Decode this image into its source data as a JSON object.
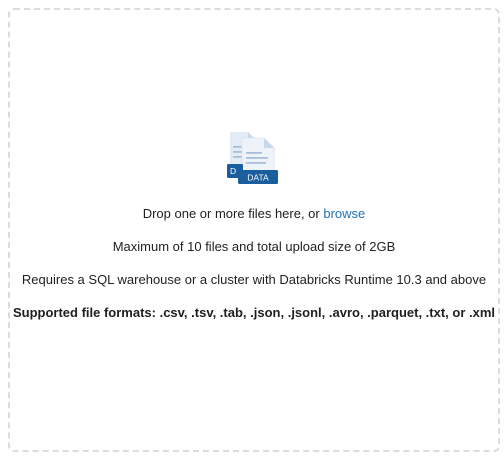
{
  "dropzone": {
    "icon": "data-file-icon",
    "icon_label": "DATA",
    "drop_text": "Drop one or more files here, or ",
    "browse_link": "browse",
    "max_text": "Maximum of 10 files and total upload size of 2GB",
    "requirement_text": "Requires a SQL warehouse or a cluster with Databricks Runtime 10.3 and above",
    "formats_text": "Supported file formats: .csv, .tsv, .tab, .json, .jsonl, .avro, .parquet, .txt, or .xml"
  },
  "colors": {
    "link": "#2272b4",
    "badge": "#1b5e9e",
    "border": "#dcdcdc"
  }
}
